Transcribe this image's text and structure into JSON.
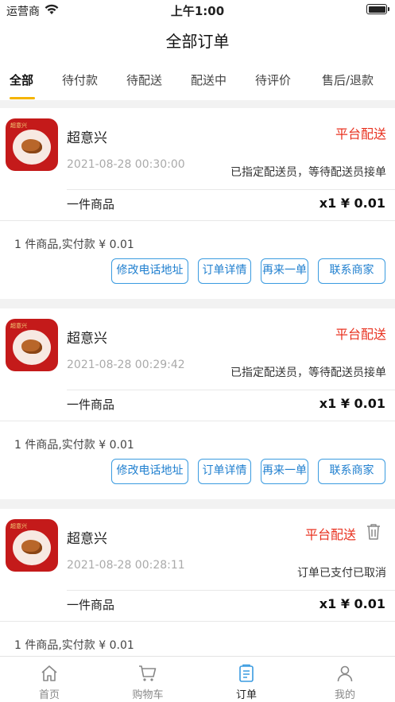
{
  "status_bar": {
    "carrier": "运营商",
    "time": "上午1:00"
  },
  "header": {
    "title": "全部订单"
  },
  "tabs": [
    {
      "label": "全部",
      "active": true
    },
    {
      "label": "待付款"
    },
    {
      "label": "待配送"
    },
    {
      "label": "配送中"
    },
    {
      "label": "待评价"
    },
    {
      "label": "售后/退款"
    }
  ],
  "orders": [
    {
      "shop_name": "超意兴",
      "logo_text": "超意兴",
      "delivery_type": "平台配送",
      "time": "2021-08-28 00:30:00",
      "status": "已指定配送员，等待配送员接单",
      "goods_label": "一件商品",
      "price": "x1 ¥ 0.01",
      "summary": "1 件商品,实付款 ¥ 0.01",
      "buttons": [
        "修改电话地址",
        "订单详情",
        "再来一单",
        "联系商家"
      ]
    },
    {
      "shop_name": "超意兴",
      "logo_text": "超意兴",
      "delivery_type": "平台配送",
      "time": "2021-08-28 00:29:42",
      "status": "已指定配送员，等待配送员接单",
      "goods_label": "一件商品",
      "price": "x1 ¥ 0.01",
      "summary": "1 件商品,实付款 ¥ 0.01",
      "buttons": [
        "修改电话地址",
        "订单详情",
        "再来一单",
        "联系商家"
      ]
    },
    {
      "shop_name": "超意兴",
      "logo_text": "超意兴",
      "delivery_type": "平台配送",
      "time": "2021-08-28 00:28:11",
      "status": "订单已支付已取消",
      "goods_label": "一件商品",
      "price": "x1 ¥ 0.01",
      "summary": "1 件商品,实付款 ¥ 0.01"
    }
  ],
  "tabbar": [
    {
      "label": "首页",
      "icon": "home-icon"
    },
    {
      "label": "购物车",
      "icon": "cart-icon"
    },
    {
      "label": "订单",
      "icon": "order-list-icon",
      "active": true
    },
    {
      "label": "我的",
      "icon": "profile-icon"
    }
  ],
  "colors": {
    "accent": "#f5b400",
    "delivery_red": "#e8311f",
    "button_blue": "#3a9be0"
  }
}
